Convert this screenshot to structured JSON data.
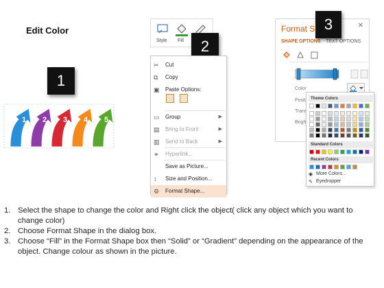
{
  "title": "Edit Color",
  "callouts": [
    "1",
    "2",
    "3"
  ],
  "arrows": [
    {
      "label": "1",
      "color": "#2b8fd6"
    },
    {
      "label": "2",
      "color": "#8e3ca6"
    },
    {
      "label": "3",
      "color": "#d42a35"
    },
    {
      "label": "4",
      "color": "#f28a1e"
    },
    {
      "label": "5",
      "color": "#5aa52f"
    }
  ],
  "ribbon": {
    "style_label": "Style",
    "fill_label": "Fill",
    "outline_label": "O"
  },
  "context_menu": {
    "items": [
      {
        "icon": "cut-icon",
        "glyph": "✂",
        "label": "Cut",
        "disabled": false
      },
      {
        "icon": "copy-icon",
        "glyph": "⧉",
        "label": "Copy",
        "disabled": false
      },
      {
        "icon": "paste-icon",
        "glyph": "▣",
        "label": "Paste Options:",
        "disabled": false
      },
      {
        "icon": "group-icon",
        "glyph": "▭",
        "label": "Group",
        "disabled": false,
        "submenu": true
      },
      {
        "icon": "bring-front-icon",
        "glyph": "▤",
        "label": "Bring to Front",
        "disabled": true,
        "submenu": true
      },
      {
        "icon": "send-back-icon",
        "glyph": "▥",
        "label": "Send to Back",
        "disabled": true,
        "submenu": true
      },
      {
        "icon": "hyperlink-icon",
        "glyph": "⚭",
        "label": "Hyperlink...",
        "disabled": true
      },
      {
        "icon": "",
        "glyph": "",
        "label": "Save as Picture...",
        "disabled": false
      },
      {
        "icon": "size-icon",
        "glyph": "↕",
        "label": "Size and Position...",
        "disabled": false
      },
      {
        "icon": "format-shape-icon",
        "glyph": "⚙",
        "label": "Format Shape...",
        "disabled": false,
        "highlight": true
      }
    ]
  },
  "format_pane": {
    "title": "Format Sh",
    "tab_shape": "SHAPE OPTIONS",
    "tab_text": "TEXT OPTIONS",
    "labels": [
      "Color",
      "Posit",
      "Trans",
      "Brigh"
    ]
  },
  "color_picker": {
    "theme_header": "Theme Colors",
    "standard_header": "Standard Colors",
    "recent_header": "Recent Colors",
    "more_colors": "More Colors...",
    "eyedropper": "Eyedropper",
    "theme_top": [
      "#ffffff",
      "#000000",
      "#e7e6e6",
      "#44546a",
      "#5b9bd5",
      "#ed7d31",
      "#a5a5a5",
      "#ffc000",
      "#4472c4",
      "#70ad47"
    ],
    "standard": [
      "#c00000",
      "#ff0000",
      "#ffc000",
      "#ffff00",
      "#92d050",
      "#00b050",
      "#00b0f0",
      "#0070c0",
      "#002060",
      "#7030a0"
    ],
    "recent": [
      "#2b8fd6",
      "#1f6fb0",
      "#8e3ca6",
      "#d42a35",
      "#f28a1e",
      "#5aa52f",
      "#3fa9e0",
      "#e87f2a"
    ]
  },
  "instructions": [
    {
      "num": "1.",
      "text": "Select the shape to change the color and Right click the object( click any object which you want to change color)"
    },
    {
      "num": "2.",
      "text": "Choose Format Shape in the dialog box."
    },
    {
      "num": "3.",
      "text": "Choose “Fill” in the Format Shape box then “Solid” or “Gradient” depending on the appearance of the object. Change colour as shown in the picture."
    }
  ]
}
